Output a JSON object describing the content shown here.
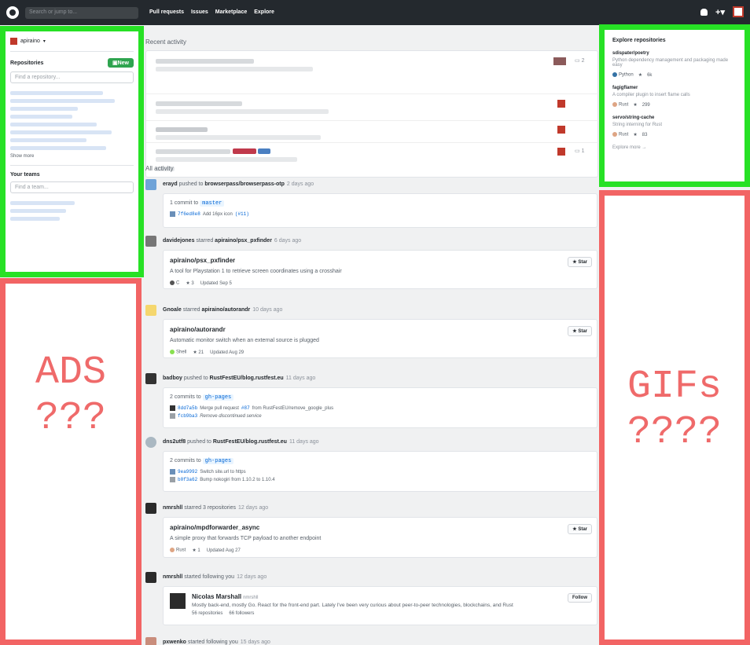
{
  "header": {
    "search_placeholder": "Search or jump to...",
    "nav": [
      "Pull requests",
      "Issues",
      "Marketplace",
      "Explore"
    ]
  },
  "sidebar": {
    "user": "apiraino",
    "repos_title": "Repositories",
    "new_label": "New",
    "find_repo_placeholder": "Find a repository...",
    "show_more": "Show more",
    "teams_title": "Your teams",
    "find_team_placeholder": "Find a team..."
  },
  "annotations": {
    "ads": "ADS\n???",
    "gifs": "GIFs\n????"
  },
  "main": {
    "recent_activity": "Recent activity",
    "all_activity": "All activity",
    "recent_comment_counts": [
      "2",
      "1"
    ]
  },
  "explore": {
    "title": "Explore repositories",
    "items": [
      {
        "name": "sdispater/poetry",
        "desc": "Python dependency management and packaging made easy",
        "lang": "Python",
        "lang_color": "#3572A5",
        "stars": "6k"
      },
      {
        "name": "fagigflamer",
        "desc": "A compiler plugin to insert flame calls",
        "lang": "Rust",
        "lang_color": "#dea584",
        "stars": "299"
      },
      {
        "name": "servo/string-cache",
        "desc": "String interning for Rust",
        "lang": "Rust",
        "lang_color": "#dea584",
        "stars": "83"
      }
    ],
    "more": "Explore more →"
  },
  "feed": [
    {
      "user": "erayd",
      "action": "pushed to",
      "target": "browserpass/browserpass-otp",
      "time": "2 days ago",
      "count_label": "1 commit to",
      "branch": "master",
      "commits": [
        {
          "sha": "7f6ed8e8",
          "msg": "Add 16px icon",
          "ref": "(#11)"
        }
      ]
    },
    {
      "user": "davidejones",
      "action": "starred",
      "target": "apiraino/psx_pxfinder",
      "time": "6 days ago",
      "repo": "apiraino/psx_pxfinder",
      "desc": "A tool for Playstation 1 to retrieve screen coordinates using a crosshair",
      "lang": "C",
      "lang_color": "#555555",
      "stars": "3",
      "updated": "Updated Sep 5",
      "star_label": "Star"
    },
    {
      "user": "Gnoale",
      "action": "starred",
      "target": "apiraino/autorandr",
      "time": "10 days ago",
      "repo": "apiraino/autorandr",
      "desc": "Automatic monitor switch when an external source is plugged",
      "lang": "Shell",
      "lang_color": "#89e051",
      "stars": "21",
      "updated": "Updated Aug 29",
      "star_label": "Star"
    },
    {
      "user": "badboy",
      "action": "pushed to",
      "target": "RustFestEU/blog.rustfest.eu",
      "time": "11 days ago",
      "count_label": "2 commits to",
      "branch": "gh-pages",
      "commits": [
        {
          "sha": "8dd7a5b",
          "msg": "Merge pull request",
          "ref": "#87",
          "tail": "from RustFestEU/remove_google_plus"
        },
        {
          "sha": "fcb9ba3",
          "msg": "Remove discontinued service",
          "ref": "",
          "tail": ""
        }
      ]
    },
    {
      "user": "dns2utf8",
      "action": "pushed to",
      "target": "RustFestEU/blog.rustfest.eu",
      "time": "11 days ago",
      "count_label": "2 commits to",
      "branch": "gh-pages",
      "commits": [
        {
          "sha": "9ea9992",
          "msg": "Switch site.url to https",
          "ref": "",
          "tail": ""
        },
        {
          "sha": "b0f3a62",
          "msg": "Bump nokogiri from 1.10.2 to 1.10.4",
          "ref": "",
          "tail": ""
        }
      ]
    },
    {
      "user": "nmrshll",
      "action": "starred 3 repositories",
      "target": "",
      "time": "12 days ago",
      "repo": "apiraino/mpdforwarder_async",
      "desc": "A simple proxy that forwards TCP payload to another endpoint",
      "lang": "Rust",
      "lang_color": "#dea584",
      "stars": "1",
      "updated": "Updated Aug 27",
      "star_label": "Star"
    },
    {
      "user": "nmrshll",
      "action": "started following you",
      "target": "",
      "time": "12 days ago",
      "person": "Nicolas Marshall",
      "handle": "nmrshll",
      "bio": "Mostly back-end, mostly Go. React for the front-end part. Lately I've been very curious about peer-to-peer technologies, blockchains, and Rust",
      "repos": "56 repositories",
      "followers": "66 followers",
      "follow_label": "Follow"
    },
    {
      "user": "pxwenko",
      "action": "started following you",
      "target": "",
      "time": "15 days ago"
    }
  ]
}
